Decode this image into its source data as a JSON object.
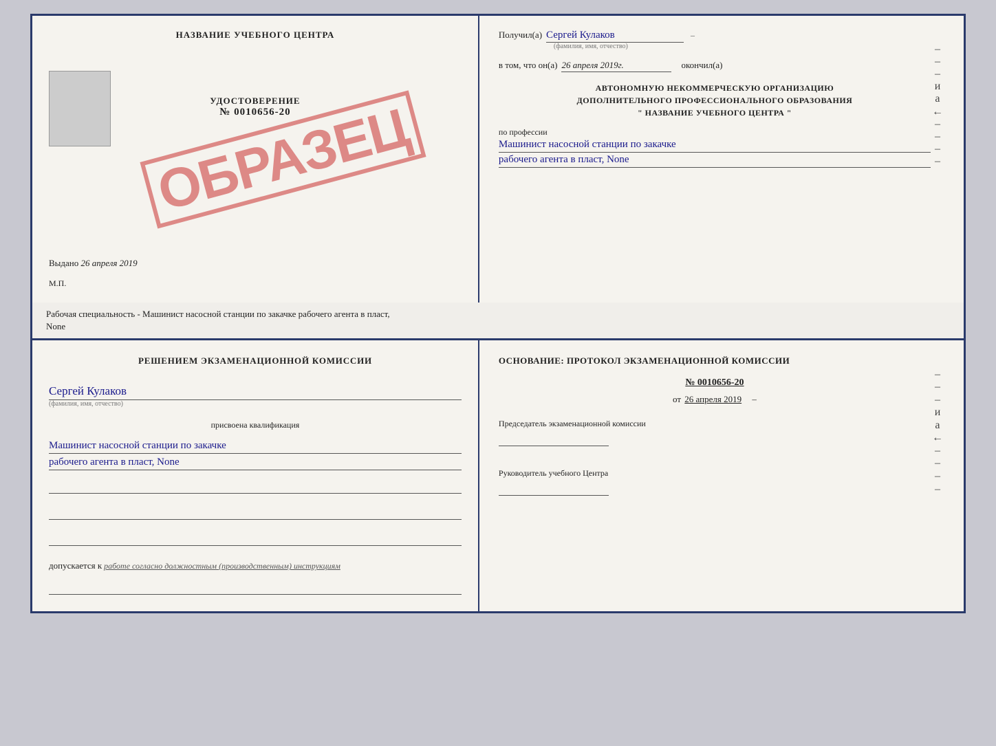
{
  "top_cert": {
    "left": {
      "school_title": "НАЗВАНИЕ УЧЕБНОГО ЦЕНТРА",
      "udost_label": "УДОСТОВЕРЕНИЕ",
      "number": "№ 0010656-20",
      "obrazec": "ОБРАЗЕЦ",
      "vydano_label": "Выдано",
      "vydano_date": "26 апреля 2019",
      "mp": "М.П."
    },
    "right": {
      "poluchil_label": "Получил(а)",
      "poluchil_name": "Сергей Кулаков",
      "poluchil_sub": "(фамилия, имя, отчество)",
      "vtom_label": "в том, что он(а)",
      "vtom_date": "26 апреля 2019г.",
      "okonchil_label": "окончил(а)",
      "block1": "АВТОНОМНУЮ НЕКОММЕРЧЕСКУЮ ОРГАНИЗАЦИЮ",
      "block2": "ДОПОЛНИТЕЛЬНОГО ПРОФЕССИОНАЛЬНОГО ОБРАЗОВАНИЯ",
      "block3": "\"   НАЗВАНИЕ УЧЕБНОГО ЦЕНТРА   \"",
      "po_professii": "по профессии",
      "profession1": "Машинист насосной станции по закачке",
      "profession2": "рабочего агента в пласт, None",
      "dashes": [
        "-",
        "-",
        "-",
        "и",
        "а",
        "←",
        "-",
        "-",
        "-",
        "-"
      ]
    }
  },
  "separator": {
    "text1": "Рабочая специальность - Машинист насосной станции по закачке рабочего агента в пласт,",
    "text2": "None"
  },
  "bottom_cert": {
    "left": {
      "komissia_text": "Решением экзаменационной комиссии",
      "name": "Сергей Кулаков",
      "name_sub": "(фамилия, имя, отчество)",
      "prisvoena": "присвоена квалификация",
      "kvali1": "Машинист насосной станции по закачке",
      "kvali2": "рабочего агента в пласт, None",
      "dopusk_label": "допускается к",
      "dopusk_value": "работе согласно должностным (производственным) инструкциям"
    },
    "right": {
      "osnovanie_label": "Основание: протокол экзаменационной комиссии",
      "number": "№ 0010656-20",
      "date_prefix": "от",
      "date": "26 апреля 2019",
      "predsedatel_label": "Председатель экзаменационной комиссии",
      "rukovoditel_label": "Руководитель учебного Центра",
      "dashes": [
        "-",
        "-",
        "-",
        "и",
        "а",
        "←",
        "-",
        "-",
        "-",
        "-"
      ]
    }
  }
}
